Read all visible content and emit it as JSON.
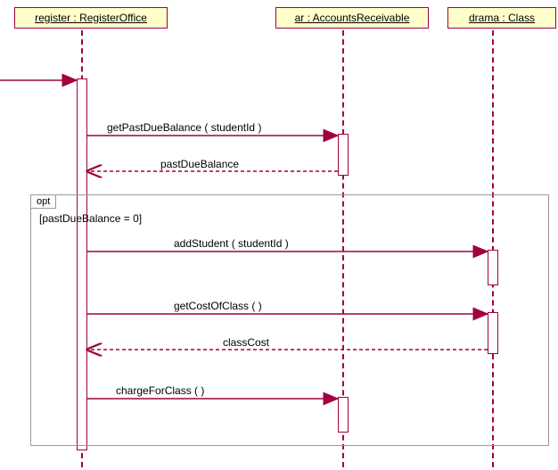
{
  "participants": {
    "register": {
      "label": "register : RegisterOffice"
    },
    "ar": {
      "label": "ar : AccountsReceivable"
    },
    "drama": {
      "label": "drama : Class"
    }
  },
  "messages": {
    "m1": {
      "label": "getPastDueBalance ( studentId )"
    },
    "r1": {
      "label": "pastDueBalance"
    },
    "m2": {
      "label": "addStudent ( studentId )"
    },
    "m3": {
      "label": "getCostOfClass (  )"
    },
    "r3": {
      "label": "classCost"
    },
    "m4": {
      "label": "chargeForClass (  )"
    }
  },
  "fragment": {
    "type": "opt",
    "guard": "[pastDueBalance = 0]"
  },
  "chart_data": {
    "type": "sequence-diagram",
    "participants": [
      {
        "id": "register",
        "label": "register : RegisterOffice"
      },
      {
        "id": "ar",
        "label": "ar : AccountsReceivable"
      },
      {
        "id": "drama",
        "label": "drama : Class"
      }
    ],
    "messages": [
      {
        "from": "external",
        "to": "register",
        "kind": "sync",
        "label": ""
      },
      {
        "from": "register",
        "to": "ar",
        "kind": "sync",
        "label": "getPastDueBalance ( studentId )"
      },
      {
        "from": "ar",
        "to": "register",
        "kind": "return",
        "label": "pastDueBalance"
      },
      {
        "from": "register",
        "to": "drama",
        "kind": "sync",
        "label": "addStudent ( studentId )",
        "fragment": "opt"
      },
      {
        "from": "register",
        "to": "drama",
        "kind": "sync",
        "label": "getCostOfClass (  )",
        "fragment": "opt"
      },
      {
        "from": "drama",
        "to": "register",
        "kind": "return",
        "label": "classCost",
        "fragment": "opt"
      },
      {
        "from": "register",
        "to": "ar",
        "kind": "sync",
        "label": "chargeForClass (  )",
        "fragment": "opt"
      }
    ],
    "fragments": [
      {
        "type": "opt",
        "guard": "[pastDueBalance = 0]",
        "covers": [
          "register",
          "ar",
          "drama"
        ]
      }
    ]
  }
}
